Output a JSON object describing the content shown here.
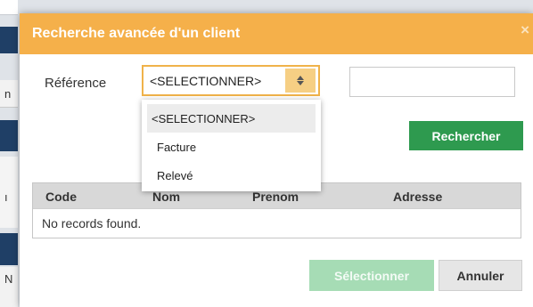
{
  "background": {
    "fragments": [
      "n",
      "ı",
      "N"
    ]
  },
  "dialog": {
    "title": "Recherche avancée d'un client",
    "close_glyph": "×",
    "header_color": "#f5b04a"
  },
  "form": {
    "reference_label": "Référence",
    "select_value": "<SELECTIONNER>",
    "text_value": "",
    "search_button": "Rechercher"
  },
  "dropdown": {
    "options": [
      "<SELECTIONNER>",
      "Facture",
      "Relevé"
    ],
    "highlighted": "<SELECTIONNER>"
  },
  "table": {
    "columns": [
      "Code",
      "Nom",
      "Prenom",
      "Adresse"
    ],
    "empty_message": "No records found."
  },
  "footer": {
    "select_button": "Sélectionner",
    "cancel_button": "Annuler"
  },
  "colors": {
    "primary_green": "#2e9a4f",
    "disabled_green": "#a6dcb5",
    "accent_orange": "#f0b24a"
  }
}
